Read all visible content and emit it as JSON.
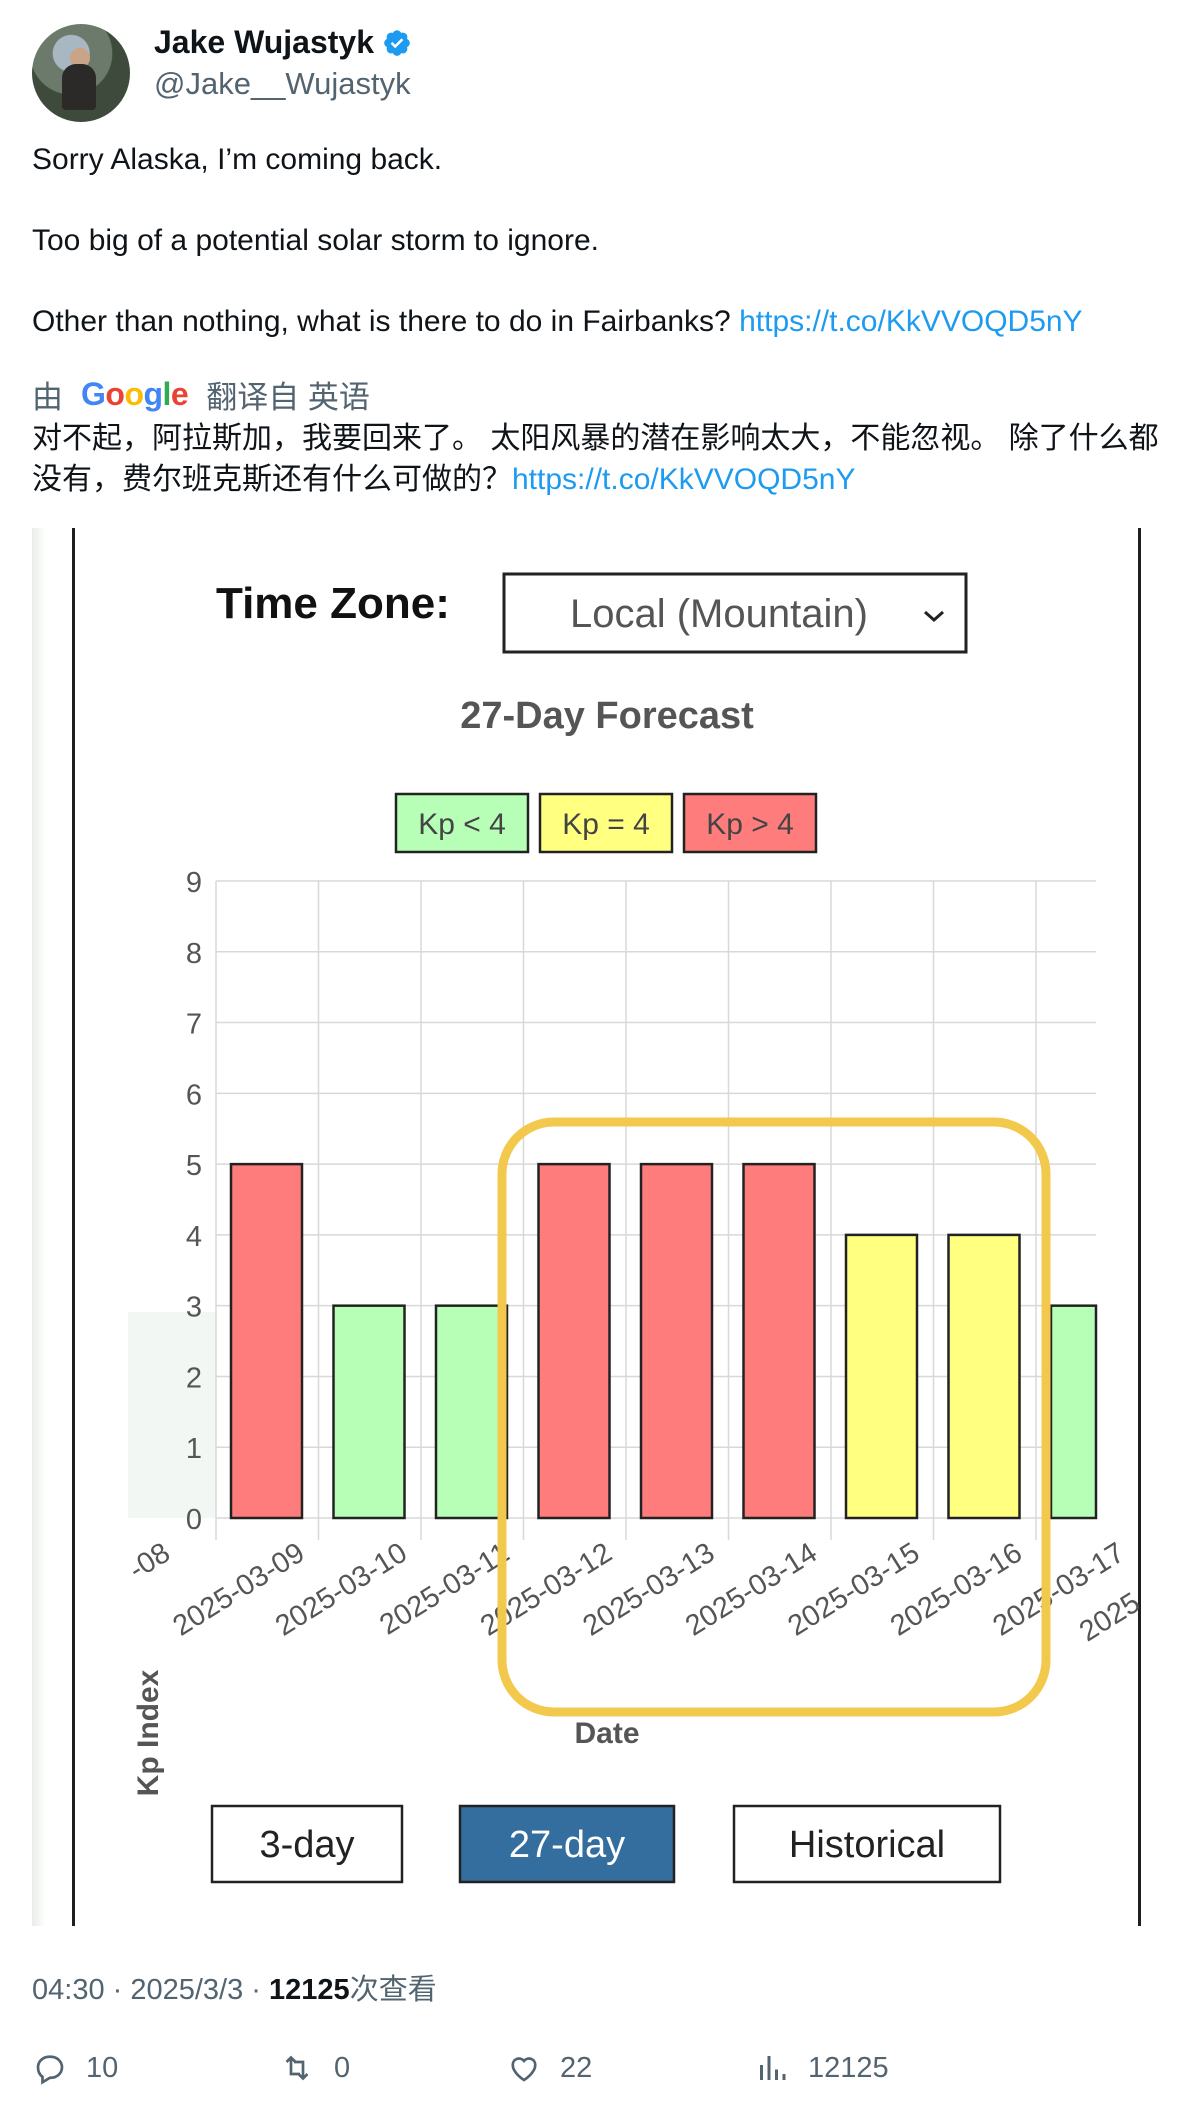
{
  "author": {
    "display_name": "Jake Wujastyk",
    "handle": "@Jake__Wujastyk"
  },
  "tweet": {
    "line1": "Sorry Alaska, I’m coming back.",
    "line2": "Too big of a potential solar storm to ignore.",
    "line3": "Other than nothing, what is there to do in Fairbanks?",
    "link": "https://t.co/KkVVOQD5nY"
  },
  "translation": {
    "prefix": "由",
    "suffix": "翻译自 英语",
    "text": "对不起，阿拉斯加，我要回来了。 太阳风暴的潜在影响太大，不能忽视。 除了什么都没有，费尔班克斯还有什么可做的？",
    "link": "https://t.co/KkVVOQD5nY"
  },
  "image": {
    "timezone_label": "Time Zone:",
    "timezone_value": "Local (Mountain)",
    "buttons": [
      "3-day",
      "27-day",
      "Historical"
    ],
    "active_button": "27-day"
  },
  "chart_data": {
    "type": "bar",
    "title": "27-Day Forecast",
    "xlabel": "Date",
    "ylabel": "Kp Index",
    "ylim": [
      0,
      9
    ],
    "yticks": [
      0,
      1,
      2,
      3,
      4,
      5,
      6,
      7,
      8,
      9
    ],
    "legend": [
      {
        "label": "Kp < 4",
        "color": "#b7ffb7"
      },
      {
        "label": "Kp = 4",
        "color": "#ffff80"
      },
      {
        "label": "Kp > 4",
        "color": "#ff7c7c"
      }
    ],
    "categories": [
      "2025-03-09",
      "2025-03-10",
      "2025-03-11",
      "2025-03-12",
      "2025-03-13",
      "2025-03-14",
      "2025-03-15",
      "2025-03-16",
      "2025-03-17"
    ],
    "values": [
      5,
      3,
      3,
      5,
      5,
      5,
      4,
      4,
      3
    ],
    "clipped_left_label": "-08",
    "clipped_right_label": "2025",
    "highlight_color": "#f2c94c"
  },
  "meta": {
    "time": "04:30",
    "date": "2025/3/3",
    "views": "12125",
    "views_suffix": "次查看"
  },
  "actions": {
    "replies": "10",
    "retweets": "0",
    "likes": "22",
    "views": "12125"
  }
}
